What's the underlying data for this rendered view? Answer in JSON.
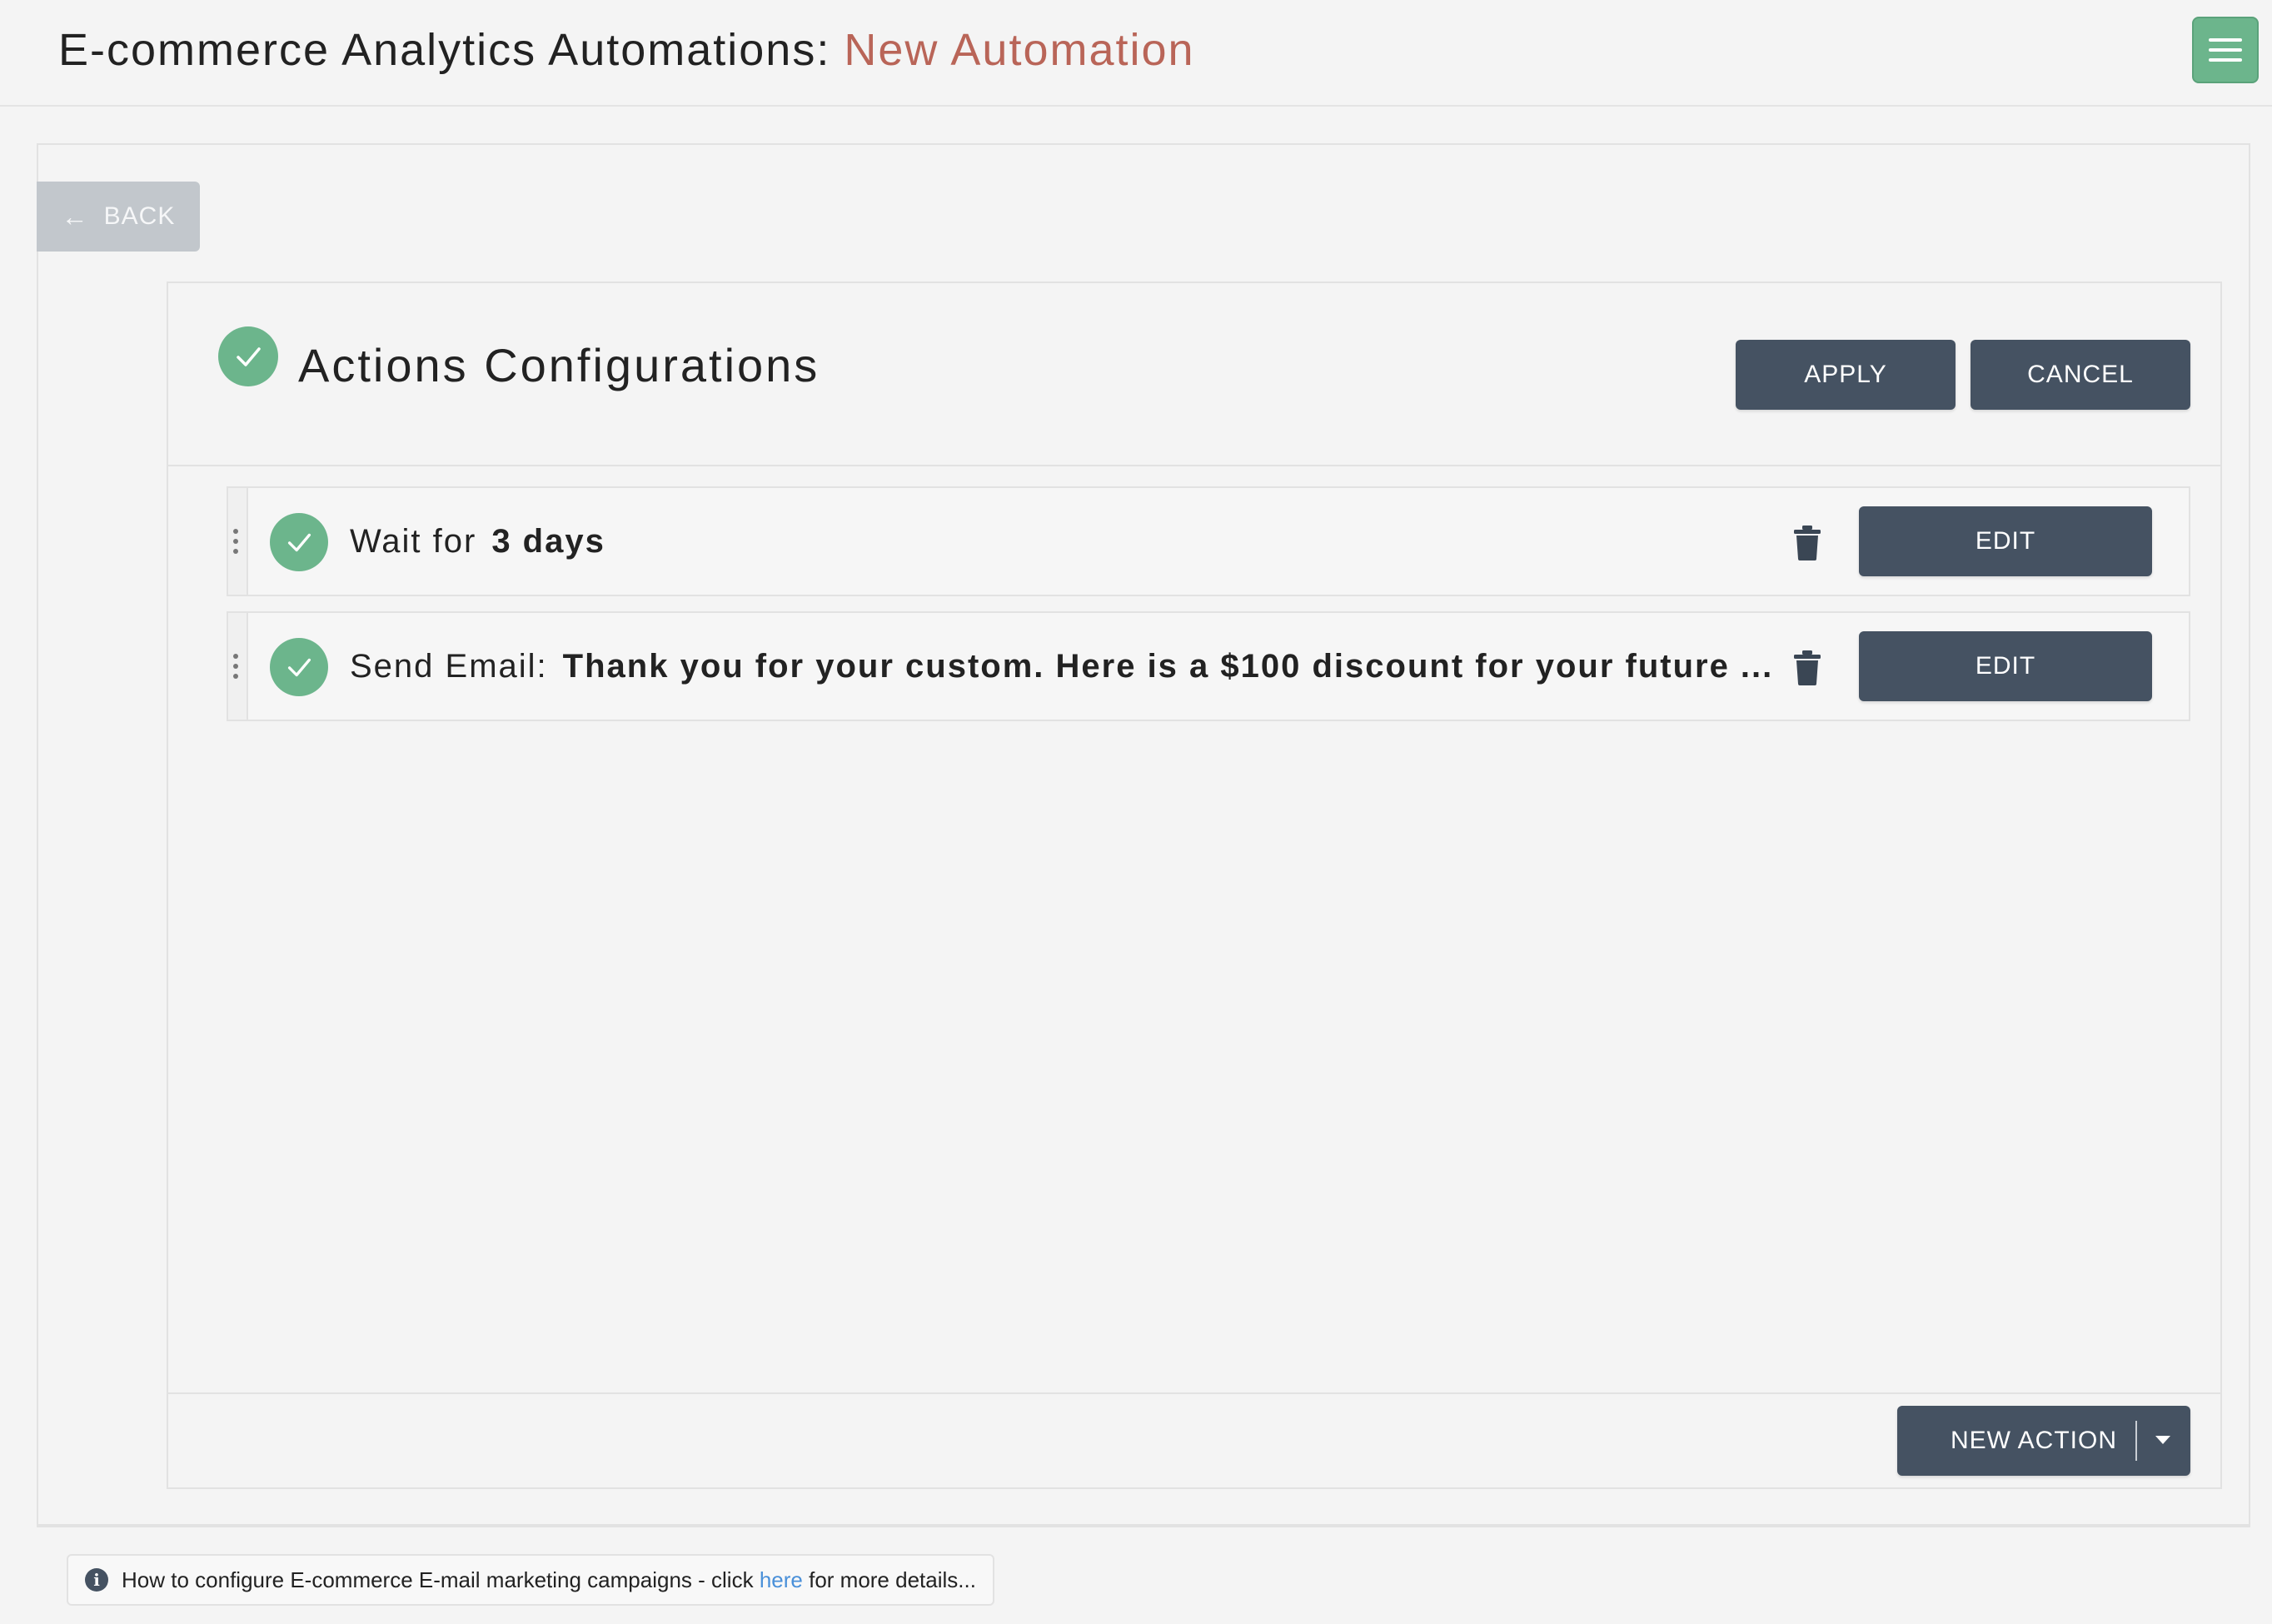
{
  "header": {
    "title": "E-commerce Analytics Automations:",
    "subtitle": "New Automation",
    "menu_icon": "hamburger-menu-icon"
  },
  "back_button": {
    "icon": "arrow-left-icon",
    "label": "BACK"
  },
  "actions_card": {
    "title": "Actions Configurations",
    "status_icon": "check-circle-icon",
    "apply_label": "APPLY",
    "cancel_label": "CANCEL",
    "rows": [
      {
        "label": "Wait for",
        "value": "3 days",
        "status_icon": "check-circle-icon",
        "delete_icon": "trash-icon",
        "edit_label": "EDIT"
      },
      {
        "label": "Send Email:",
        "value": "Thank you for your custom. Here is a $100 discount for your future ...",
        "status_icon": "check-circle-icon",
        "delete_icon": "trash-icon",
        "edit_label": "EDIT"
      }
    ],
    "new_action_label": "NEW ACTION",
    "new_action_dropdown_icon": "caret-down-icon"
  },
  "info": {
    "icon": "info-icon",
    "text_before": "How to configure E-commerce E-mail marketing campaigns - click",
    "link_text": "here",
    "text_after": "for more details..."
  },
  "colors": {
    "accent_green": "#6cb58c",
    "title_highlight": "#b96558",
    "button_dark": "#455262",
    "back_button": "#c2c7cc",
    "link": "#4a90d9"
  }
}
